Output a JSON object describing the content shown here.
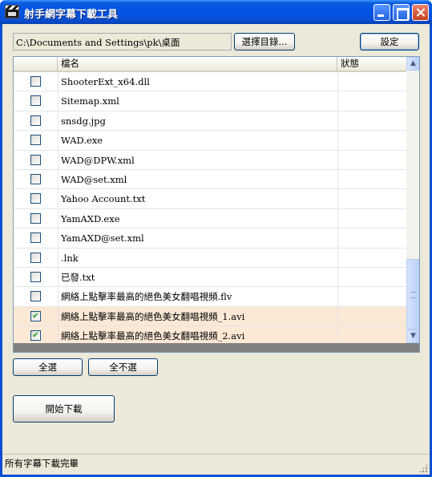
{
  "window": {
    "title": "射手網字幕下載工具",
    "icon": "clapperboard-icon"
  },
  "toolbar": {
    "path": "C:\\Documents and Settings\\pk\\桌面",
    "browse_label": "選擇目錄...",
    "settings_label": "設定"
  },
  "grid": {
    "columns": [
      "",
      "檔名",
      "狀態"
    ],
    "rows": [
      {
        "checked": false,
        "name": "ShooterExt_x64.dll",
        "status": ""
      },
      {
        "checked": false,
        "name": "Sitemap.xml",
        "status": ""
      },
      {
        "checked": false,
        "name": "snsdg.jpg",
        "status": ""
      },
      {
        "checked": false,
        "name": "WAD.exe",
        "status": ""
      },
      {
        "checked": false,
        "name": "WAD@DPW.xml",
        "status": ""
      },
      {
        "checked": false,
        "name": "WAD@set.xml",
        "status": ""
      },
      {
        "checked": false,
        "name": "Yahoo Account.txt",
        "status": ""
      },
      {
        "checked": false,
        "name": "YamAXD.exe",
        "status": ""
      },
      {
        "checked": false,
        "name": "YamAXD@set.xml",
        "status": ""
      },
      {
        "checked": false,
        "name": "                 .lnk",
        "status": ""
      },
      {
        "checked": false,
        "name": "已發.txt",
        "status": ""
      },
      {
        "checked": false,
        "name": "網絡上點擊率最高的絕色美女翻唱視頻.flv",
        "status": ""
      },
      {
        "checked": true,
        "name": "網絡上點擊率最高的絕色美女翻唱視頻_1.avi",
        "status": ""
      },
      {
        "checked": true,
        "name": "網絡上點擊率最高的絕色美女翻唱視頻_2.avi",
        "status": ""
      }
    ]
  },
  "actions": {
    "select_all_label": "全選",
    "select_none_label": "全不選",
    "start_label": "開始下載"
  },
  "statusbar": {
    "text": "所有字幕下載完畢"
  },
  "colors": {
    "titlebar": "#0054e3",
    "client": "#ece9d8",
    "selected_row": "#fbe9d6",
    "checkmark": "#21a121"
  }
}
